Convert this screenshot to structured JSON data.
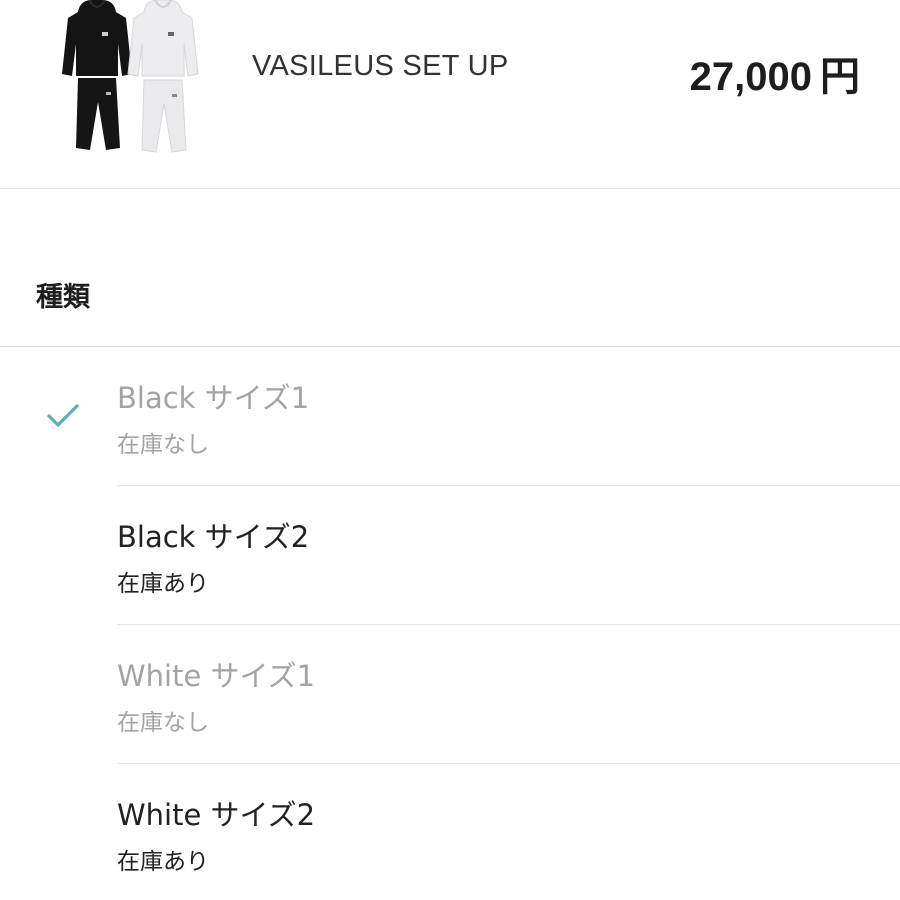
{
  "product": {
    "name": "VASILEUS SET UP",
    "price": "27,000",
    "price_unit": "円",
    "thumbnail_icon": "tracksuit-set-image"
  },
  "section": {
    "heading": "種類"
  },
  "options": [
    {
      "label": "Black サイズ1",
      "stock": "在庫なし",
      "selected": true,
      "available": false
    },
    {
      "label": "Black サイズ2",
      "stock": "在庫あり",
      "selected": false,
      "available": true
    },
    {
      "label": "White サイズ1",
      "stock": "在庫なし",
      "selected": false,
      "available": false
    },
    {
      "label": "White サイズ2",
      "stock": "在庫あり",
      "selected": false,
      "available": true
    }
  ],
  "colors": {
    "check_accent": "#5bb0b0",
    "text_primary": "#222222",
    "text_disabled": "#a3a3a3",
    "divider": "#e6e6e6"
  }
}
